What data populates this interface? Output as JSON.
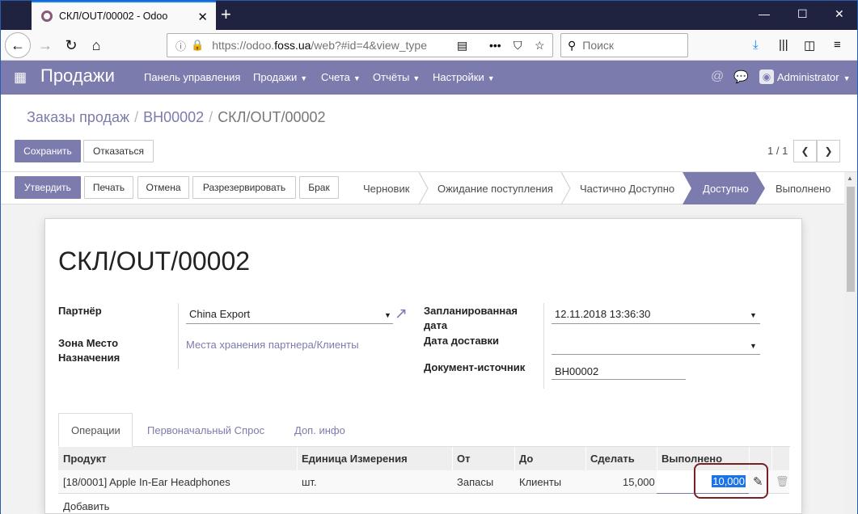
{
  "browser": {
    "tab_title": "СКЛ/OUT/00002 - Odoo",
    "url_main": "https://odoo.",
    "url_domain": "foss.ua",
    "url_rest": "/web?#id=4&view_type",
    "search_placeholder": "Поиск"
  },
  "app": {
    "name": "Продажи",
    "menu": [
      {
        "label": "Панель управления",
        "dropdown": false
      },
      {
        "label": "Продажи",
        "dropdown": true
      },
      {
        "label": "Счета",
        "dropdown": true
      },
      {
        "label": "Отчёты",
        "dropdown": true
      },
      {
        "label": "Настройки",
        "dropdown": true
      }
    ],
    "user": "Administrator"
  },
  "breadcrumb": {
    "items": [
      "Заказы продаж",
      "ВН00002",
      "СКЛ/OUT/00002"
    ]
  },
  "actions": {
    "save": "Сохранить",
    "discard": "Отказаться",
    "pager": "1 / 1"
  },
  "status_buttons": [
    "Утвердить",
    "Печать",
    "Отмена",
    "Разрезервировать",
    "Брак"
  ],
  "stages": {
    "items": [
      "Черновик",
      "Ожидание поступления",
      "Частично Доступно",
      "Доступно",
      "Выполнено"
    ],
    "active": "Доступно"
  },
  "form": {
    "title": "СКЛ/OUT/00002",
    "partner_label": "Партнёр",
    "partner_value": "China Export",
    "dest_label": "Зона Место Назначения",
    "dest_value": "Места хранения партнера/Клиенты",
    "scheduled_label": "Запланированная дата",
    "scheduled_value": "12.11.2018 13:36:30",
    "delivery_label": "Дата доставки",
    "delivery_value": "",
    "source_label": "Документ-источник",
    "source_value": "ВН00002"
  },
  "notebook": {
    "tabs": [
      "Операции",
      "Первоначальный Спрос",
      "Доп. инфо"
    ],
    "active": "Операции"
  },
  "table": {
    "headers": [
      "Продукт",
      "Единица Измерения",
      "От",
      "До",
      "Сделать",
      "Выполнено"
    ],
    "rows": [
      {
        "product": "[18/0001] Apple In-Ear Headphones",
        "uom": "шт.",
        "from": "Запасы",
        "to": "Клиенты",
        "todo": "15,000",
        "done": "10,000"
      }
    ],
    "add_label": "Добавить"
  },
  "colors": {
    "brand": "#7c7bad",
    "highlight_ring": "#7a1f24"
  }
}
